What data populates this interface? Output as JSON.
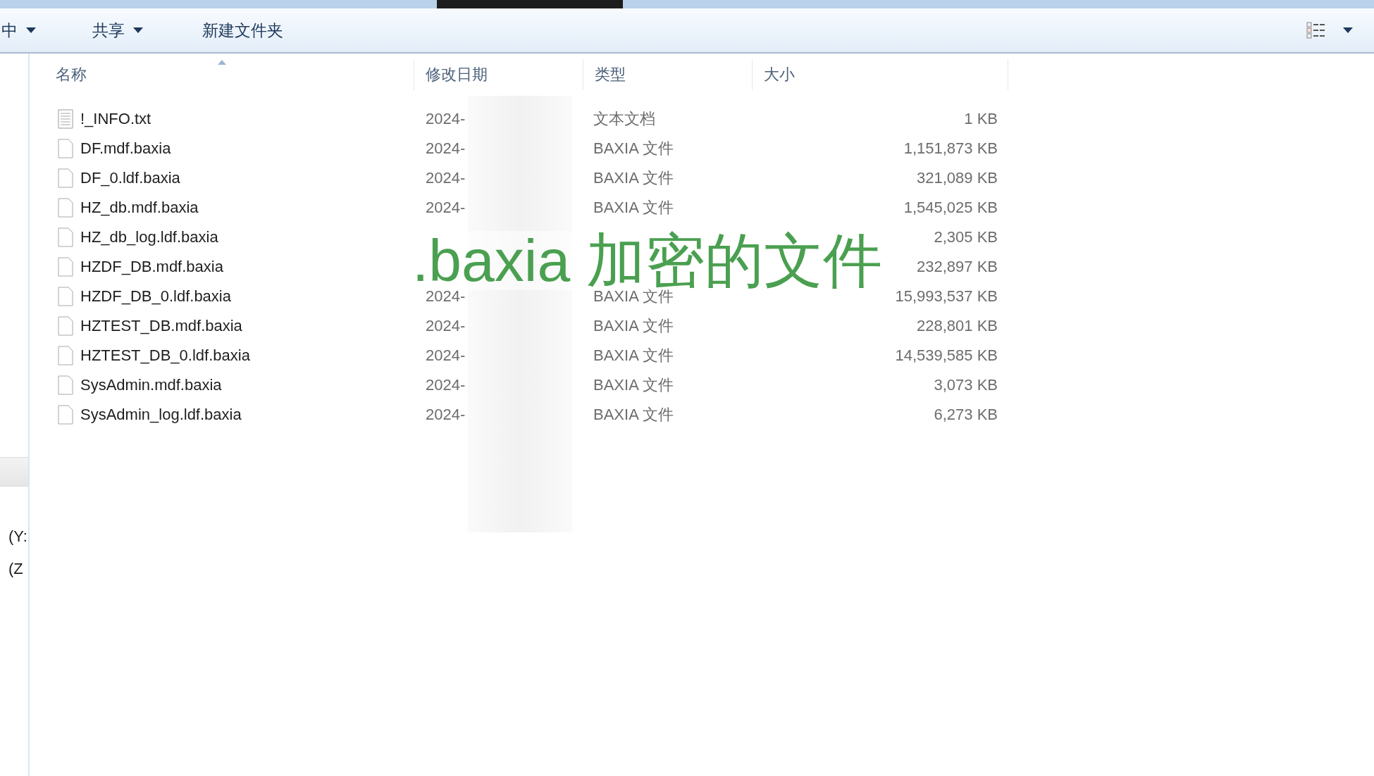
{
  "toolbar": {
    "items": [
      {
        "label": "中",
        "dropdown": true
      },
      {
        "label": "共享",
        "dropdown": true
      },
      {
        "label": "新建文件夹",
        "dropdown": false
      }
    ]
  },
  "navigation": {
    "items": [
      "(Y:",
      "(Z"
    ]
  },
  "table": {
    "columns": [
      {
        "label": "名称",
        "sorted": true
      },
      {
        "label": "修改日期",
        "sorted": false
      },
      {
        "label": "类型",
        "sorted": false
      },
      {
        "label": "大小",
        "sorted": false
      }
    ],
    "rows": [
      {
        "kind": "text",
        "name": "!_INFO.txt",
        "date": "2024-",
        "type": "文本文档",
        "size": "1 KB"
      },
      {
        "kind": "file",
        "name": "DF.mdf.baxia",
        "date": "2024-",
        "type": "BAXIA 文件",
        "size": "1,151,873 KB"
      },
      {
        "kind": "file",
        "name": "DF_0.ldf.baxia",
        "date": "2024-",
        "type": "BAXIA 文件",
        "size": "321,089 KB"
      },
      {
        "kind": "file",
        "name": "HZ_db.mdf.baxia",
        "date": "2024-",
        "type": "BAXIA 文件",
        "size": "1,545,025 KB"
      },
      {
        "kind": "file",
        "name": "HZ_db_log.ldf.baxia",
        "size": "2,305 KB"
      },
      {
        "kind": "file",
        "name": "HZDF_DB.mdf.baxia",
        "size": "232,897 KB"
      },
      {
        "kind": "file",
        "name": "HZDF_DB_0.ldf.baxia",
        "date": "2024-",
        "type": "BAXIA 文件",
        "size": "15,993,537 KB"
      },
      {
        "kind": "file",
        "name": "HZTEST_DB.mdf.baxia",
        "date": "2024-",
        "type": "BAXIA 文件",
        "size": "228,801 KB"
      },
      {
        "kind": "file",
        "name": "HZTEST_DB_0.ldf.baxia",
        "date": "2024-",
        "type": "BAXIA 文件",
        "size": "14,539,585 KB"
      },
      {
        "kind": "file",
        "name": "SysAdmin.mdf.baxia",
        "date": "2024-",
        "type": "BAXIA 文件",
        "size": "3,073 KB"
      },
      {
        "kind": "file",
        "name": "SysAdmin_log.ldf.baxia",
        "date": "2024-",
        "type": "BAXIA 文件",
        "size": "6,273 KB"
      }
    ]
  },
  "caption": ".baxia 加密的文件"
}
